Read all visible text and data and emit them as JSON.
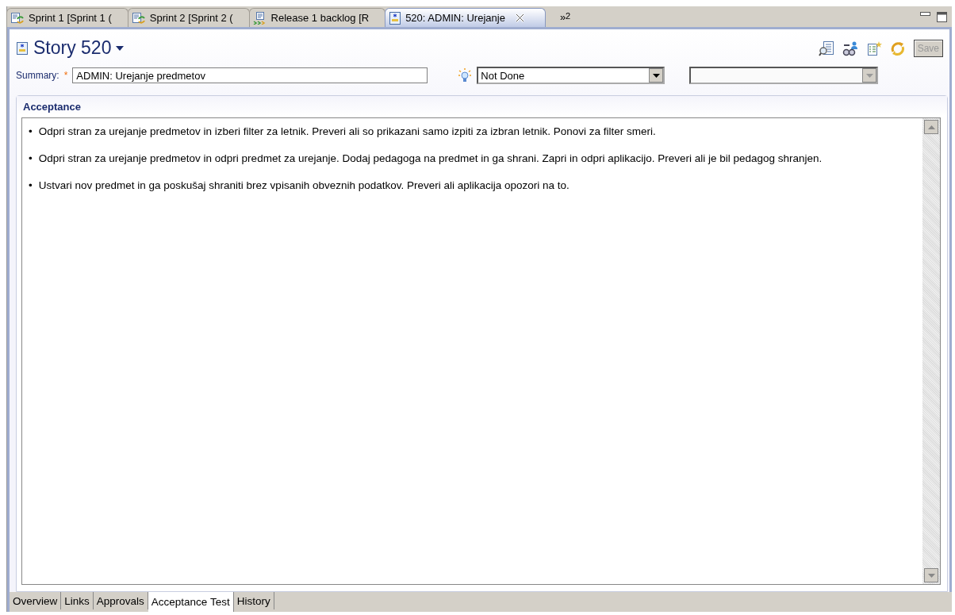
{
  "editor_tabs": [
    {
      "label": "Sprint 1 [Sprint 1 (",
      "kind": "sprint",
      "selected": false
    },
    {
      "label": "Sprint 2 [Sprint 2 (",
      "kind": "sprint",
      "selected": false
    },
    {
      "label": "Release 1 backlog [R",
      "kind": "release",
      "selected": false
    },
    {
      "label": "520: ADMIN: Urejanje",
      "kind": "story",
      "selected": true
    }
  ],
  "overflow": {
    "chevron": "»",
    "count": "2"
  },
  "header": {
    "title": "Story 520"
  },
  "toolbar": {
    "save": {
      "label": "Save",
      "disabled": true
    }
  },
  "summary": {
    "label": "Summary:",
    "required": "*",
    "value": "ADMIN: Urejanje predmetov"
  },
  "status": {
    "value": "Not Done"
  },
  "resolution": {
    "disabled": true
  },
  "section": {
    "title": "Acceptance",
    "items": [
      {
        "bullet": "•",
        "text": "Odpri stran za urejanje predmetov in izberi filter za letnik. Preveri ali so prikazani samo izpiti za izbran letnik. Ponovi za filter smeri."
      },
      {
        "bullet": "•",
        "text": "Odpri stran za urejanje predmetov in odpri predmet za urejanje. Dodaj pedagoga na predmet in ga shrani. Zapri in odpri aplikacijo. Preveri ali je bil pedagog shranjen."
      },
      {
        "bullet": "•",
        "text": "Ustvari nov predmet in ga poskušaj shraniti brez vpisanih obveznih podatkov. Preveri ali aplikacija opozori na to."
      }
    ]
  },
  "page_tabs": [
    {
      "label": "Overview",
      "selected": false
    },
    {
      "label": "Links",
      "selected": false
    },
    {
      "label": "Approvals",
      "selected": false
    },
    {
      "label": "Acceptance Test",
      "selected": true
    },
    {
      "label": "History",
      "selected": false
    }
  ]
}
